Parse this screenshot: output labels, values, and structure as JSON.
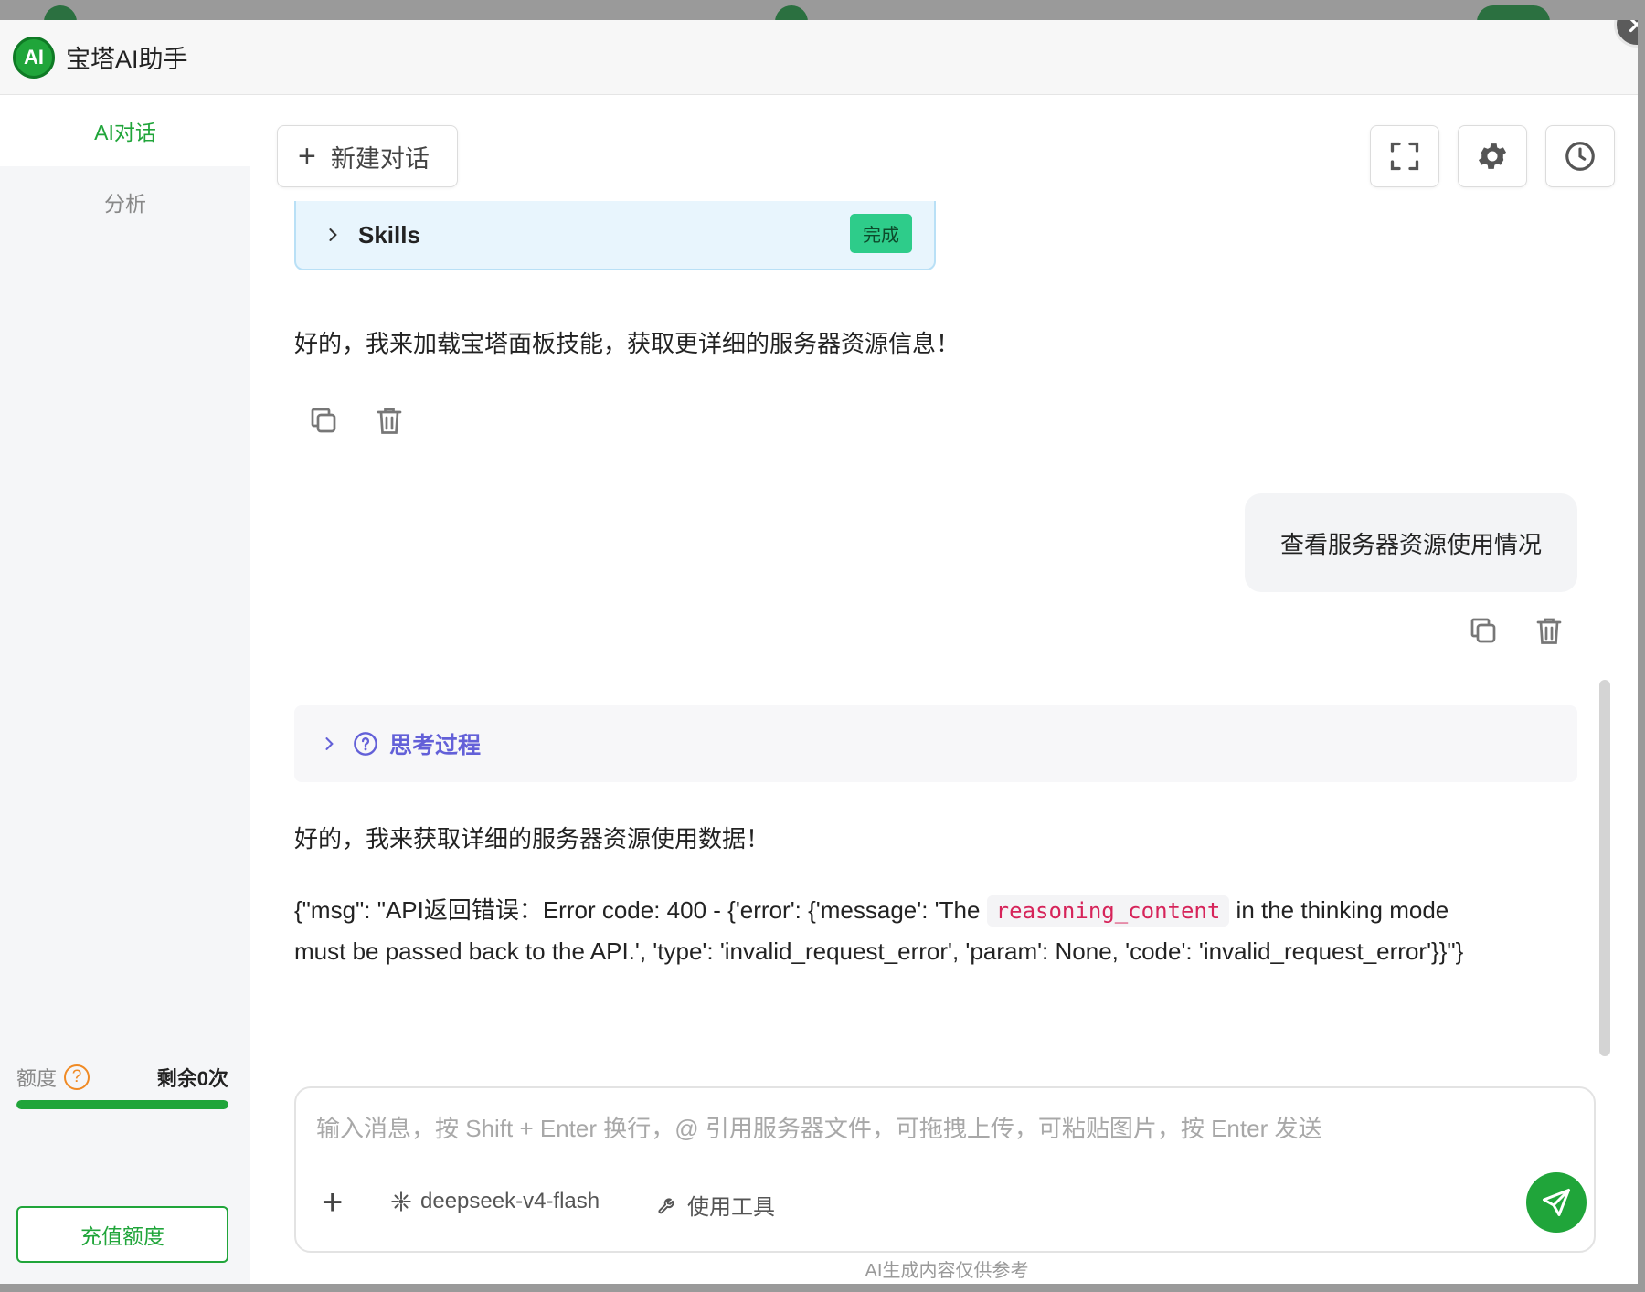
{
  "app": {
    "title": "宝塔AI助手",
    "logo_text": "AI"
  },
  "sidebar": {
    "items": [
      {
        "label": "AI对话",
        "active": true
      },
      {
        "label": "分析",
        "active": false
      }
    ],
    "quota": {
      "label": "额度",
      "help": "?",
      "remaining": "剩余0次",
      "progress_percent": 100
    },
    "recharge_label": "充值额度"
  },
  "toolbar": {
    "new_chat_label": "新建对话",
    "icons": [
      "fullscreen-icon",
      "settings-gear-icon",
      "history-clock-icon"
    ]
  },
  "conversation": {
    "skills_card": {
      "title": "Skills",
      "status": "完成"
    },
    "assistant_msg_1": "好的，我来加载宝塔面板技能，获取更详细的服务器资源信息！",
    "user_msg": "查看服务器资源使用情况",
    "thinking_label": "思考过程",
    "assistant_msg_2": "好的，我来获取详细的服务器资源使用数据！",
    "error": {
      "part1": "{\"msg\": \"API返回错误：Error code: 400 - {'error': {'message': 'The ",
      "code": "reasoning_content",
      "part2": " in the thinking mode must be passed back to the API.', 'type': 'invalid_request_error', 'param': None, 'code': 'invalid_request_error'}}\"}"
    }
  },
  "input": {
    "placeholder": "输入消息，按 Shift + Enter 换行，@ 引用服务器文件，可拖拽上传，可粘贴图片，按 Enter 发送",
    "value": "",
    "model": "deepseek-v4-flash",
    "tools_label": "使用工具"
  },
  "disclaimer": "AI生成内容仅供参考",
  "colors": {
    "brand_green": "#20a53a",
    "thinking_purple": "#6360d8",
    "code_red": "#d6245a",
    "badge_green": "#2ecc8a"
  }
}
